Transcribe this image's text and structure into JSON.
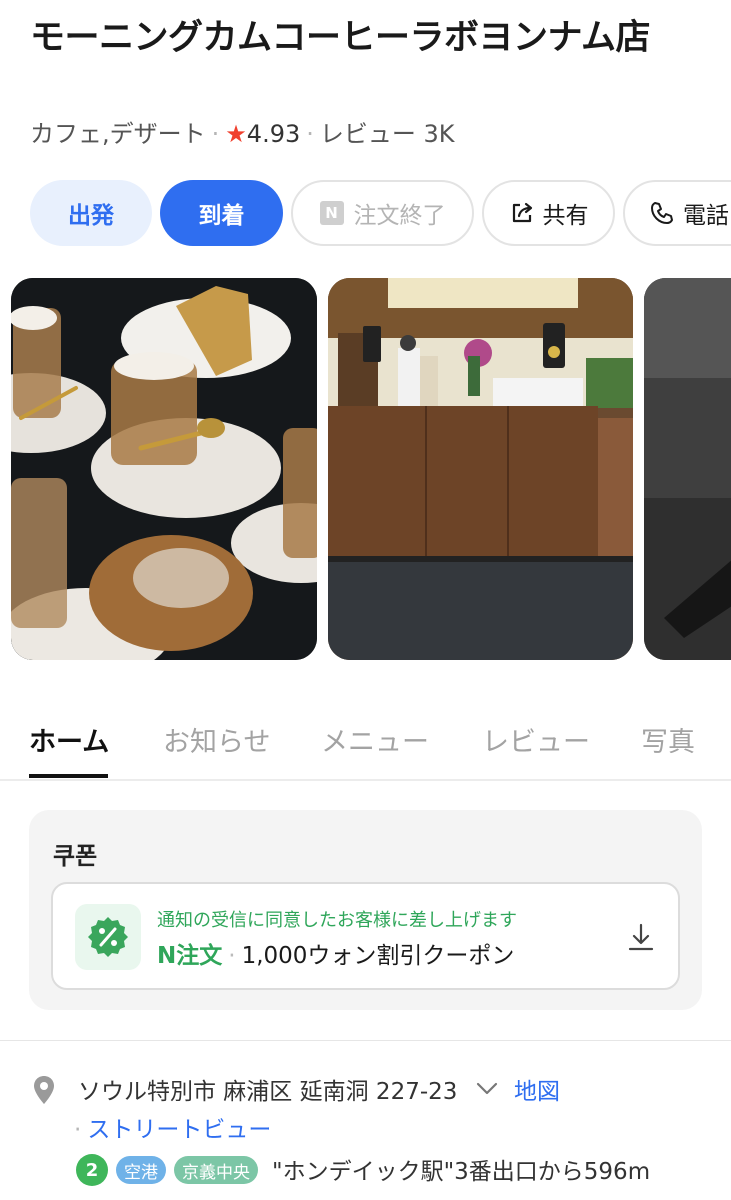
{
  "place": {
    "name": "モーニングカムコーヒーラボヨンナム店",
    "category": "カフェ,デザート",
    "rating": "4.93",
    "reviews": "レビュー 3K"
  },
  "actions": {
    "depart": "出発",
    "arrive": "到着",
    "order_badge": "N",
    "order": "注文終了",
    "share": "共有",
    "call": "電話"
  },
  "tabs": [
    "ホーム",
    "お知らせ",
    "メニュー",
    "レビュー",
    "写真"
  ],
  "coupon": {
    "title": "쿠폰",
    "notice": "通知の受信に同意したお客様に差し上げます",
    "brand_n": "N",
    "brand_label": "注文",
    "description": "1,000ウォン割引クーポン"
  },
  "address": {
    "text": "ソウル特別市 麻浦区 延南洞 227-23",
    "map_link": "地図",
    "street_view": "ストリートビュー"
  },
  "transit": {
    "line_number": "2",
    "airport_line": "空港",
    "gyeongui_line": "京義中央",
    "directions": "\"ホンデイック駅\"3番出口から596m"
  },
  "colors": {
    "accent": "#2f6ef0",
    "star": "#f0402e",
    "coupon_green": "#2fa65a"
  },
  "icons": [
    "star-icon",
    "share-icon",
    "phone-icon",
    "coupon-percent-icon",
    "download-icon",
    "location-pin-icon",
    "chevron-down-icon"
  ]
}
